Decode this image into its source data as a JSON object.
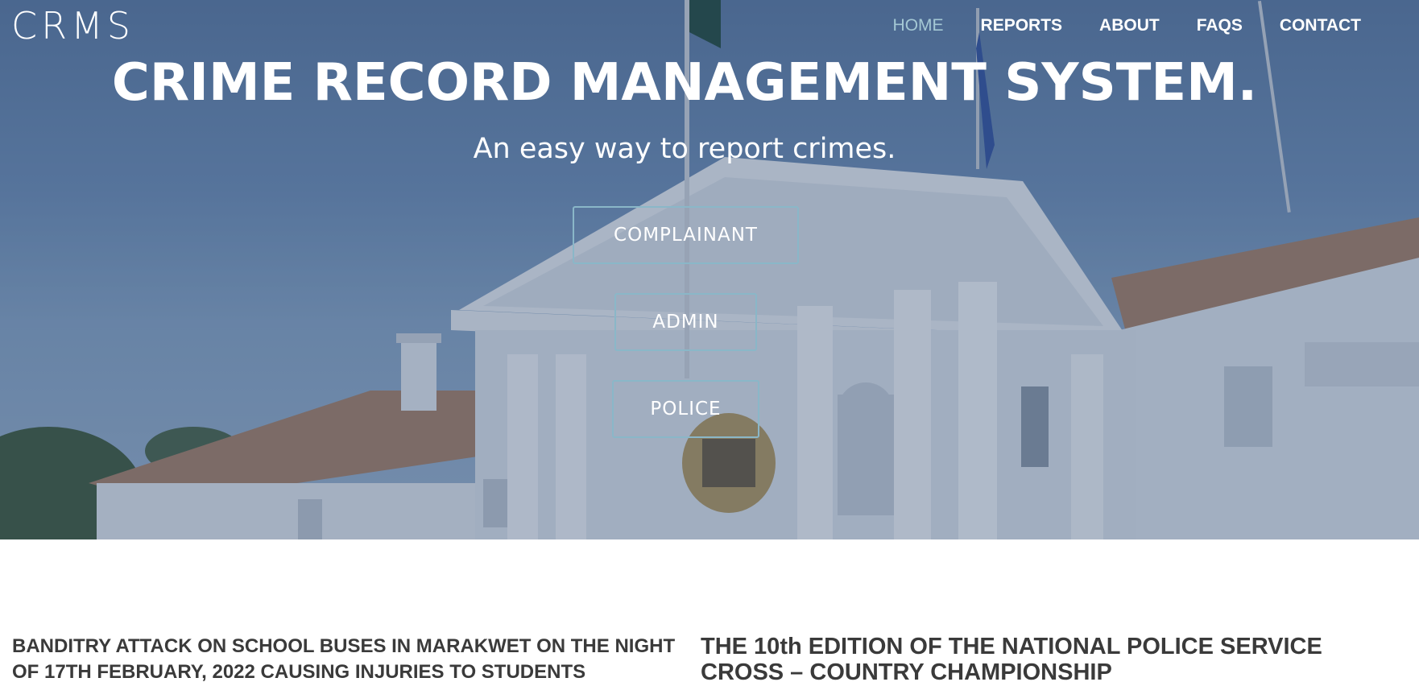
{
  "header": {
    "logo": "CRMS",
    "nav": [
      {
        "label": "HOME",
        "active": true
      },
      {
        "label": "REPORTS",
        "active": false
      },
      {
        "label": "ABOUT",
        "active": false
      },
      {
        "label": "FAQS",
        "active": false
      },
      {
        "label": "CONTACT",
        "active": false
      }
    ]
  },
  "hero": {
    "title": "CRIME RECORD MANAGEMENT SYSTEM.",
    "subtitle": "An easy way to report crimes.",
    "buttons": {
      "complainant": "COMPLAINANT",
      "admin": "ADMIN",
      "police": "POLICE"
    }
  },
  "news": [
    {
      "headline": "BANDITRY ATTACK ON SCHOOL BUSES IN MARAKWET ON THE NIGHT OF 17TH FEBRUARY, 2022 CAUSING INJURIES TO STUDENTS"
    },
    {
      "headline": "THE 10th EDITION OF THE NATIONAL POLICE SERVICE CROSS – COUNTRY CHAMPIONSHIP"
    }
  ],
  "colors": {
    "nav_active": "#a4c8d4",
    "button_border": "#8ab7c8",
    "headline_text": "#3a3a3a"
  },
  "icons": {
    "hero_background": "government-building-photo"
  }
}
